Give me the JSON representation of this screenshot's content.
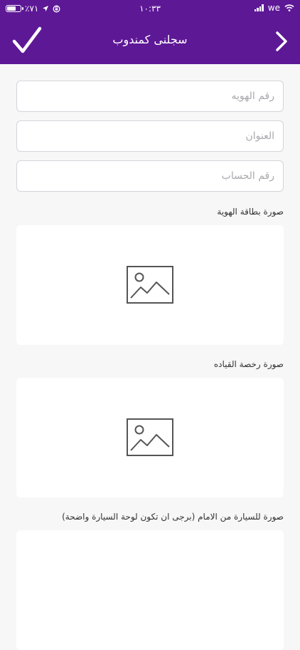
{
  "status_bar": {
    "battery_percent": "٪٧١",
    "battery_level": 0.71,
    "time": "١٠:٣٣",
    "carrier": "we"
  },
  "header": {
    "title": "سجلنى كمندوب",
    "confirm_icon": "checkmark-icon",
    "forward_icon": "chevron-right-icon"
  },
  "form": {
    "id_number_placeholder": "رقم الهويه",
    "address_placeholder": "العنوان",
    "account_number_placeholder": "رقم الحساب",
    "id_card_photo_label": "صورة بطاقة الهوية",
    "license_photo_label": "صورة رخصة القياده",
    "car_front_photo_label": "صورة للسيارة من الامام (برجى ان تكون لوحة السيارة واضحة)",
    "upload_icon": "image-placeholder-icon"
  },
  "colors": {
    "brand": "#5d1896",
    "background": "#f7f7f8",
    "field_border": "#d5d5da",
    "icon_gray": "#555555"
  }
}
